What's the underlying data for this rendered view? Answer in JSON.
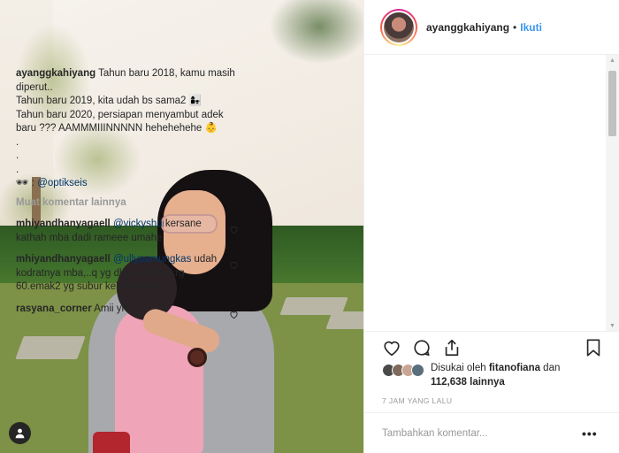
{
  "post": {
    "username": "ayanggkahiyang",
    "separator": "•",
    "follow_label": "Ikuti"
  },
  "caption": {
    "username": "ayanggkahiyang",
    "lines": [
      "Tahun baru 2018, kamu masih diperut..",
      "Tahun baru 2019, kita udah bs sama2 👩‍👧",
      "Tahun baru 2020, persiapan menyambut adek baru ??? AAMMMIIINNNNN hehehehehe 👶",
      ".",
      ".",
      ".",
      "🕶 : "
    ],
    "mention": "@optikseis"
  },
  "load_more_label": "Muat komentar lainnya",
  "comments": [
    {
      "username": "mhiyandhanyagaell",
      "mention": "@vickyshu",
      "text": " kersane kathah mba dadi rameee umahe"
    },
    {
      "username": "mhiyandhanyagaell",
      "mention": "@ullypamungkas",
      "text": " udah kodratnya mba,..q yg dl Bb 45an skrg 60.emak2 yg subur kekanan kiri"
    },
    {
      "username": "rasyana_corner",
      "mention": "",
      "text": " Amii yra"
    }
  ],
  "likes": {
    "prefix": "Disukai oleh ",
    "first_user": "fitanofiana",
    "joiner": " dan",
    "count_text": "112,638 lainnya"
  },
  "timestamp": "7 JAM YANG LALU",
  "add_comment_placeholder": "Tambahkan komentar...",
  "more_label": "•••",
  "colors": {
    "link_blue": "#3897f0",
    "mention_blue": "#003569",
    "muted": "#999999",
    "text": "#262626"
  },
  "icons": [
    "user-tag-icon",
    "heart-icon",
    "comment-icon",
    "share-icon",
    "bookmark-icon",
    "more-options-icon"
  ]
}
